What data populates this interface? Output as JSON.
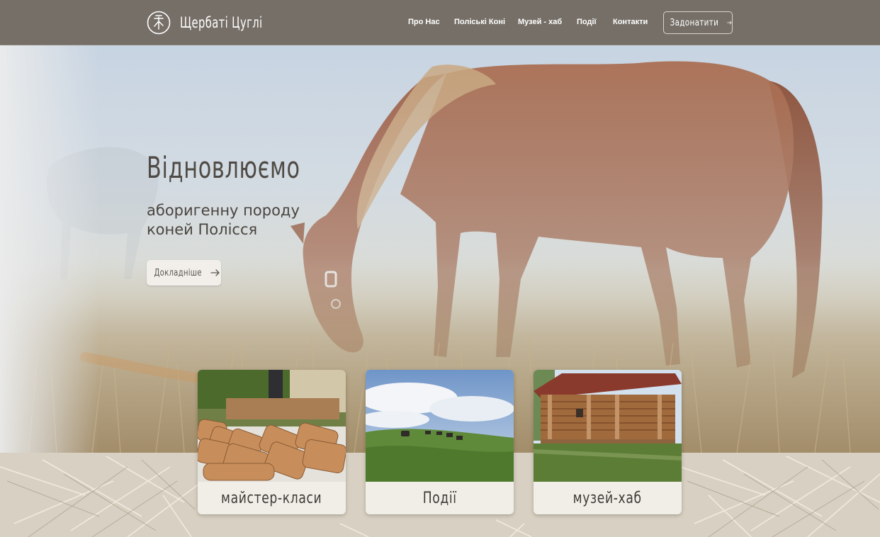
{
  "header": {
    "brand": "Щербаті Цуглі",
    "logo_icon": "horse-emblem-icon",
    "nav": [
      {
        "label": "Про Нас"
      },
      {
        "label": "Поліські Коні"
      },
      {
        "label": "Музей - хаб"
      },
      {
        "label": "Події"
      },
      {
        "label": "Контакти"
      }
    ],
    "donate_label": "Задонатити",
    "donate_icon": "arrow-right-icon"
  },
  "hero": {
    "title": "Відновлюємо",
    "subtitle": "аборигенну породу коней Полісся",
    "button_label": "Докладніше",
    "button_icon": "arrow-right-icon",
    "background_image": "chestnut-horse-grazing-in-misty-field"
  },
  "cards": [
    {
      "label": "майстер-класи",
      "image": "homemade-bread-loaves"
    },
    {
      "label": "Події",
      "image": "horses-on-green-hill"
    },
    {
      "label": "музей-хаб",
      "image": "wooden-log-house"
    }
  ],
  "colors": {
    "header_bg": "#756f67",
    "text_dark": "#4f4a44",
    "card_bg": "#f1eee8",
    "button_bg": "#f2efea"
  }
}
